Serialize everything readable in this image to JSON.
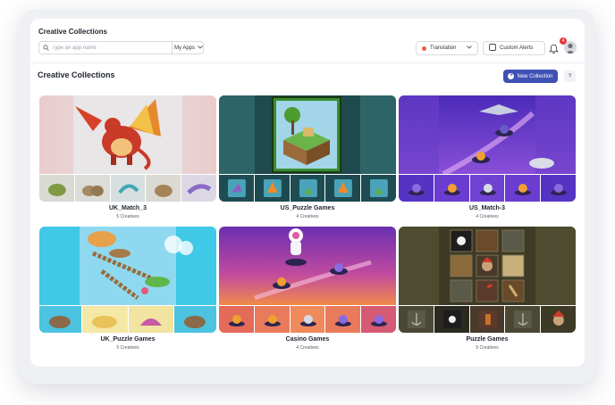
{
  "header": {
    "app_title": "Creative Collections",
    "search": {
      "placeholder": "Type an app name",
      "value": ""
    },
    "apps_select": {
      "label": "My Apps"
    },
    "translation_label": "Translation",
    "alerts_label": "Custom Alerts",
    "notification_count": "4"
  },
  "main": {
    "title": "Creative Collections",
    "new_button_label": "New Collection",
    "help_label": "?"
  },
  "collections": [
    {
      "name": "UK_Match_3",
      "count": "5 Creatives",
      "theme": "dragon"
    },
    {
      "name": "US_Puzzle Games",
      "count": "4 Creatives",
      "theme": "island"
    },
    {
      "name": "US_Match-3",
      "count": "4 Creatives",
      "theme": "space"
    },
    {
      "name": "UK_Puzzle Games",
      "count": "5 Creatives",
      "theme": "bridge"
    },
    {
      "name": "Casino Games",
      "count": "4 Creatives",
      "theme": "casino"
    },
    {
      "name": "Puzzle Games",
      "count": "5 Creatives",
      "theme": "pirate"
    }
  ],
  "colors": {
    "accent": "#3f51b5",
    "badge": "#e5383b",
    "translation_dot": "#f05c45"
  }
}
